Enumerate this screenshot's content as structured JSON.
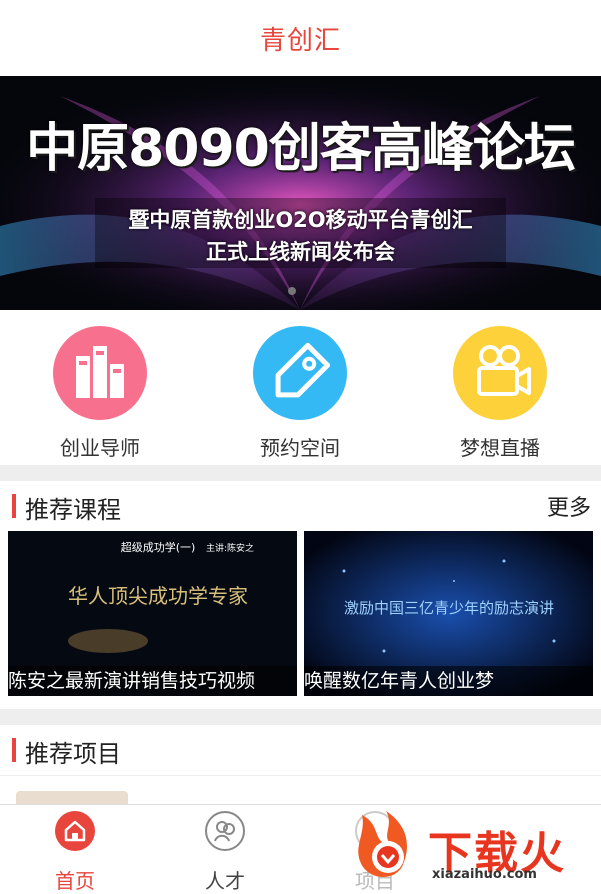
{
  "header": {
    "title": "青创汇"
  },
  "banner": {
    "title": "中原8090创客高峰论坛",
    "line1": "暨中原首款创业O2O移动平台青创汇",
    "line2": "正式上线新闻发布会"
  },
  "quick_links": [
    {
      "label": "创业导师",
      "icon": "books-icon",
      "color": "#f7718f"
    },
    {
      "label": "预约空间",
      "icon": "tag-icon",
      "color": "#35b9f4"
    },
    {
      "label": "梦想直播",
      "icon": "video-camera-icon",
      "color": "#fcd13a"
    }
  ],
  "courses_section": {
    "title": "推荐课程",
    "more": "更多"
  },
  "courses": [
    {
      "caption": "陈安之最新演讲销售技巧视频",
      "overlay_top": "超级成功学(一)",
      "overlay_speaker": "主讲:陈安之",
      "overlay_main": "华人顶尖成功学专家"
    },
    {
      "caption": "唤醒数亿年青人创业梦",
      "overlay_main": "激励中国三亿青少年的励志演讲"
    }
  ],
  "projects_section": {
    "title": "推荐项目"
  },
  "tabs": [
    {
      "label": "首页",
      "icon": "home-icon",
      "active": true
    },
    {
      "label": "人才",
      "icon": "people-icon",
      "active": false
    },
    {
      "label": "项目",
      "icon": "project-icon",
      "active": false
    }
  ],
  "watermark": {
    "text": "下载火",
    "sub": "xiazaihuo.com"
  },
  "colors": {
    "accent": "#e8453c",
    "tab_inactive": "#444444"
  }
}
